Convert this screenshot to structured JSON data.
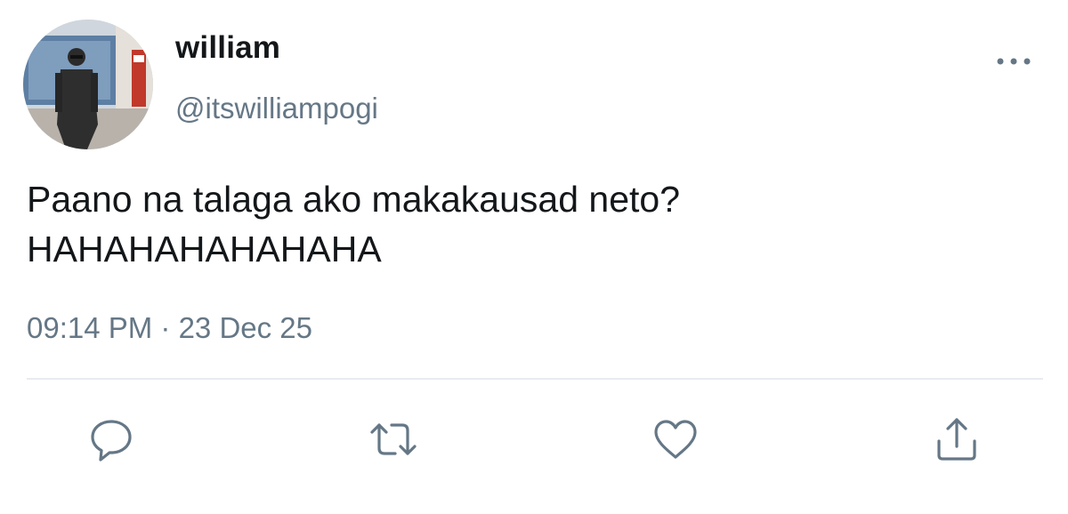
{
  "user": {
    "display_name": "william",
    "handle": "@itswilliampogi"
  },
  "tweet": {
    "lines": [
      "Paano na talaga ako makakausad neto?",
      "HAHAHAHAHAHAHA"
    ],
    "timestamp": "09:14 PM · 23 Dec 25"
  },
  "icons": {
    "more": "more-horizontal-icon",
    "reply": "speech-bubble-icon",
    "retweet": "retweet-arrows-icon",
    "like": "heart-icon",
    "share": "share-upload-icon"
  },
  "colors": {
    "text_primary": "#14171a",
    "text_secondary": "#657786",
    "icon": "#657786",
    "divider": "#e6ecf0"
  }
}
